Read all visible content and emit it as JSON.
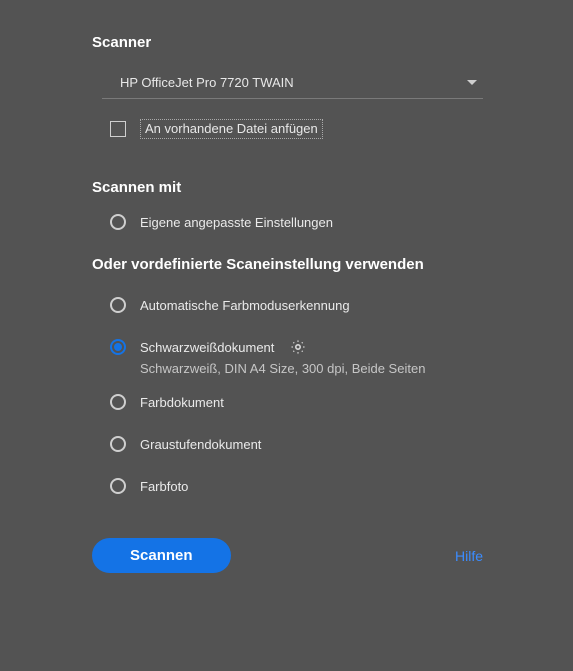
{
  "scanner": {
    "title": "Scanner",
    "selected": "HP OfficeJet Pro 7720 TWAIN",
    "append_label": "An vorhandene Datei anfügen"
  },
  "scan_with": {
    "title": "Scannen mit",
    "custom_option": "Eigene angepasste Einstellungen"
  },
  "presets": {
    "title": "Oder vordefinierte Scaneinstellung verwenden",
    "items": [
      {
        "label": "Automatische Farbmoduserkennung",
        "selected": false
      },
      {
        "label": "Schwarzweißdokument",
        "selected": true,
        "sub": "Schwarzweiß, DIN A4 Size, 300 dpi, Beide Seiten"
      },
      {
        "label": "Farbdokument",
        "selected": false
      },
      {
        "label": "Graustufendokument",
        "selected": false
      },
      {
        "label": "Farbfoto",
        "selected": false
      }
    ]
  },
  "footer": {
    "scan": "Scannen",
    "help": "Hilfe"
  }
}
